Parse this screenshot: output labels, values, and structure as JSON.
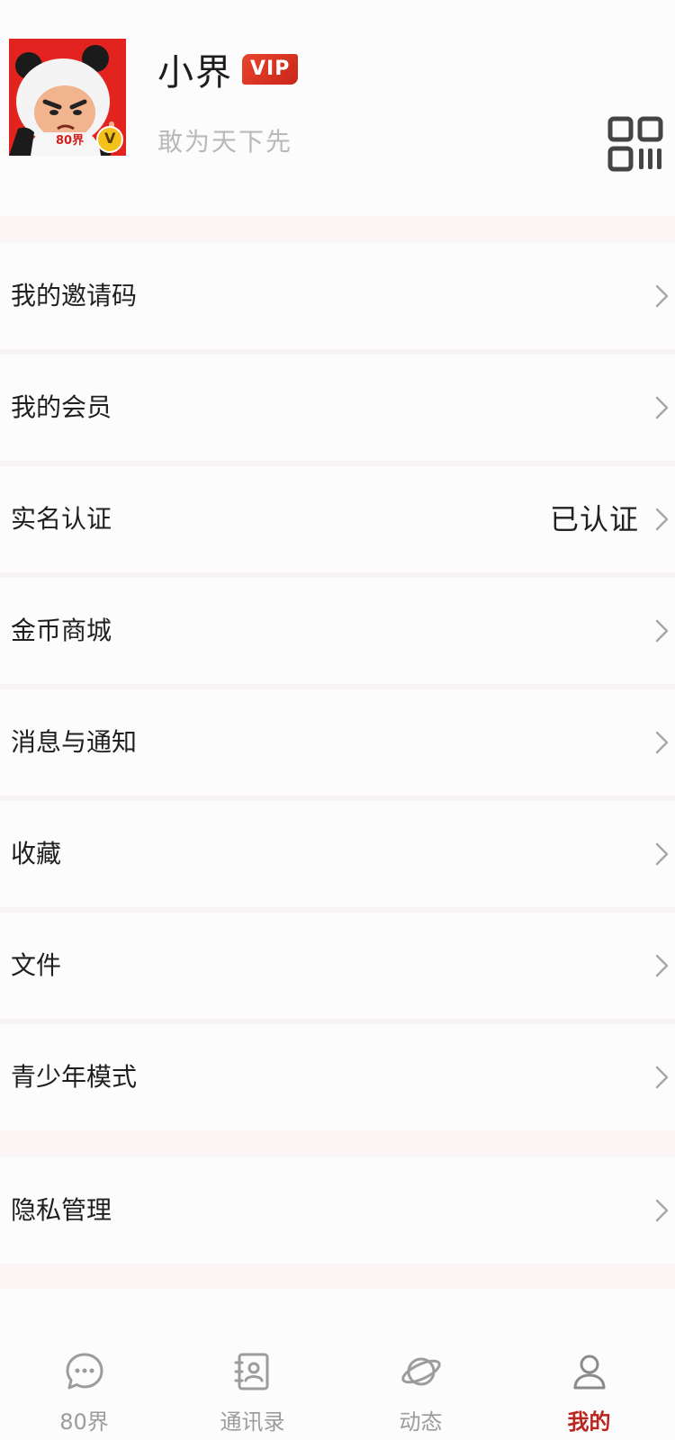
{
  "profile": {
    "name": "小界",
    "vip_badge": "VIP",
    "signature": "敢为天下先",
    "avatar_badge_text": "80界",
    "avatar_v_badge": "V"
  },
  "menu": {
    "invite_code": "我的邀请码",
    "membership": "我的会员",
    "real_name": "实名认证",
    "real_name_status": "已认证",
    "coin_mall": "金币商城",
    "notifications": "消息与通知",
    "favorites": "收藏",
    "files": "文件",
    "teen_mode": "青少年模式",
    "privacy": "隐私管理"
  },
  "tabs": [
    {
      "label": "80界",
      "icon": "chat-bubble-icon",
      "active": false
    },
    {
      "label": "通讯录",
      "icon": "contacts-book-icon",
      "active": false
    },
    {
      "label": "动态",
      "icon": "planet-icon",
      "active": false
    },
    {
      "label": "我的",
      "icon": "person-icon",
      "active": true
    }
  ],
  "colors": {
    "accent": "#b8261f",
    "avatar_bg": "#e2231f",
    "vip_badge": "#d9331f",
    "inactive_tab": "#9c9c9c",
    "secondary_text": "#b9b9b9"
  }
}
